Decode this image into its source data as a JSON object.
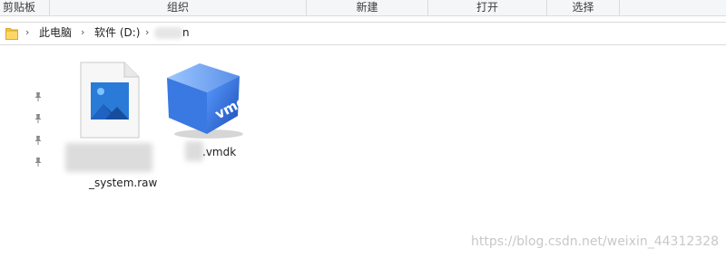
{
  "ribbon": {
    "groups": [
      "剪贴板",
      "组织",
      "新建",
      "打开",
      "选择"
    ]
  },
  "address_bar": {
    "crumbs": [
      "此电脑",
      "软件 (D:)",
      "n"
    ]
  },
  "quick_access": {
    "pins": [
      "pin-icon",
      "pin-icon",
      "pin-icon",
      "pin-icon"
    ]
  },
  "files": [
    {
      "name": "_system.raw",
      "icon": "image-file-icon"
    },
    {
      "name": ".vmdk",
      "icon": "vmdk-file-icon",
      "icon_text": "vmdk"
    }
  ],
  "watermark": "https://blog.csdn.net/weixin_44312328",
  "colors": {
    "vmdk_blue": "#2f6fd8",
    "image_icon_blue": "#2a7ad8",
    "folder_yellow": "#f5c94a"
  }
}
